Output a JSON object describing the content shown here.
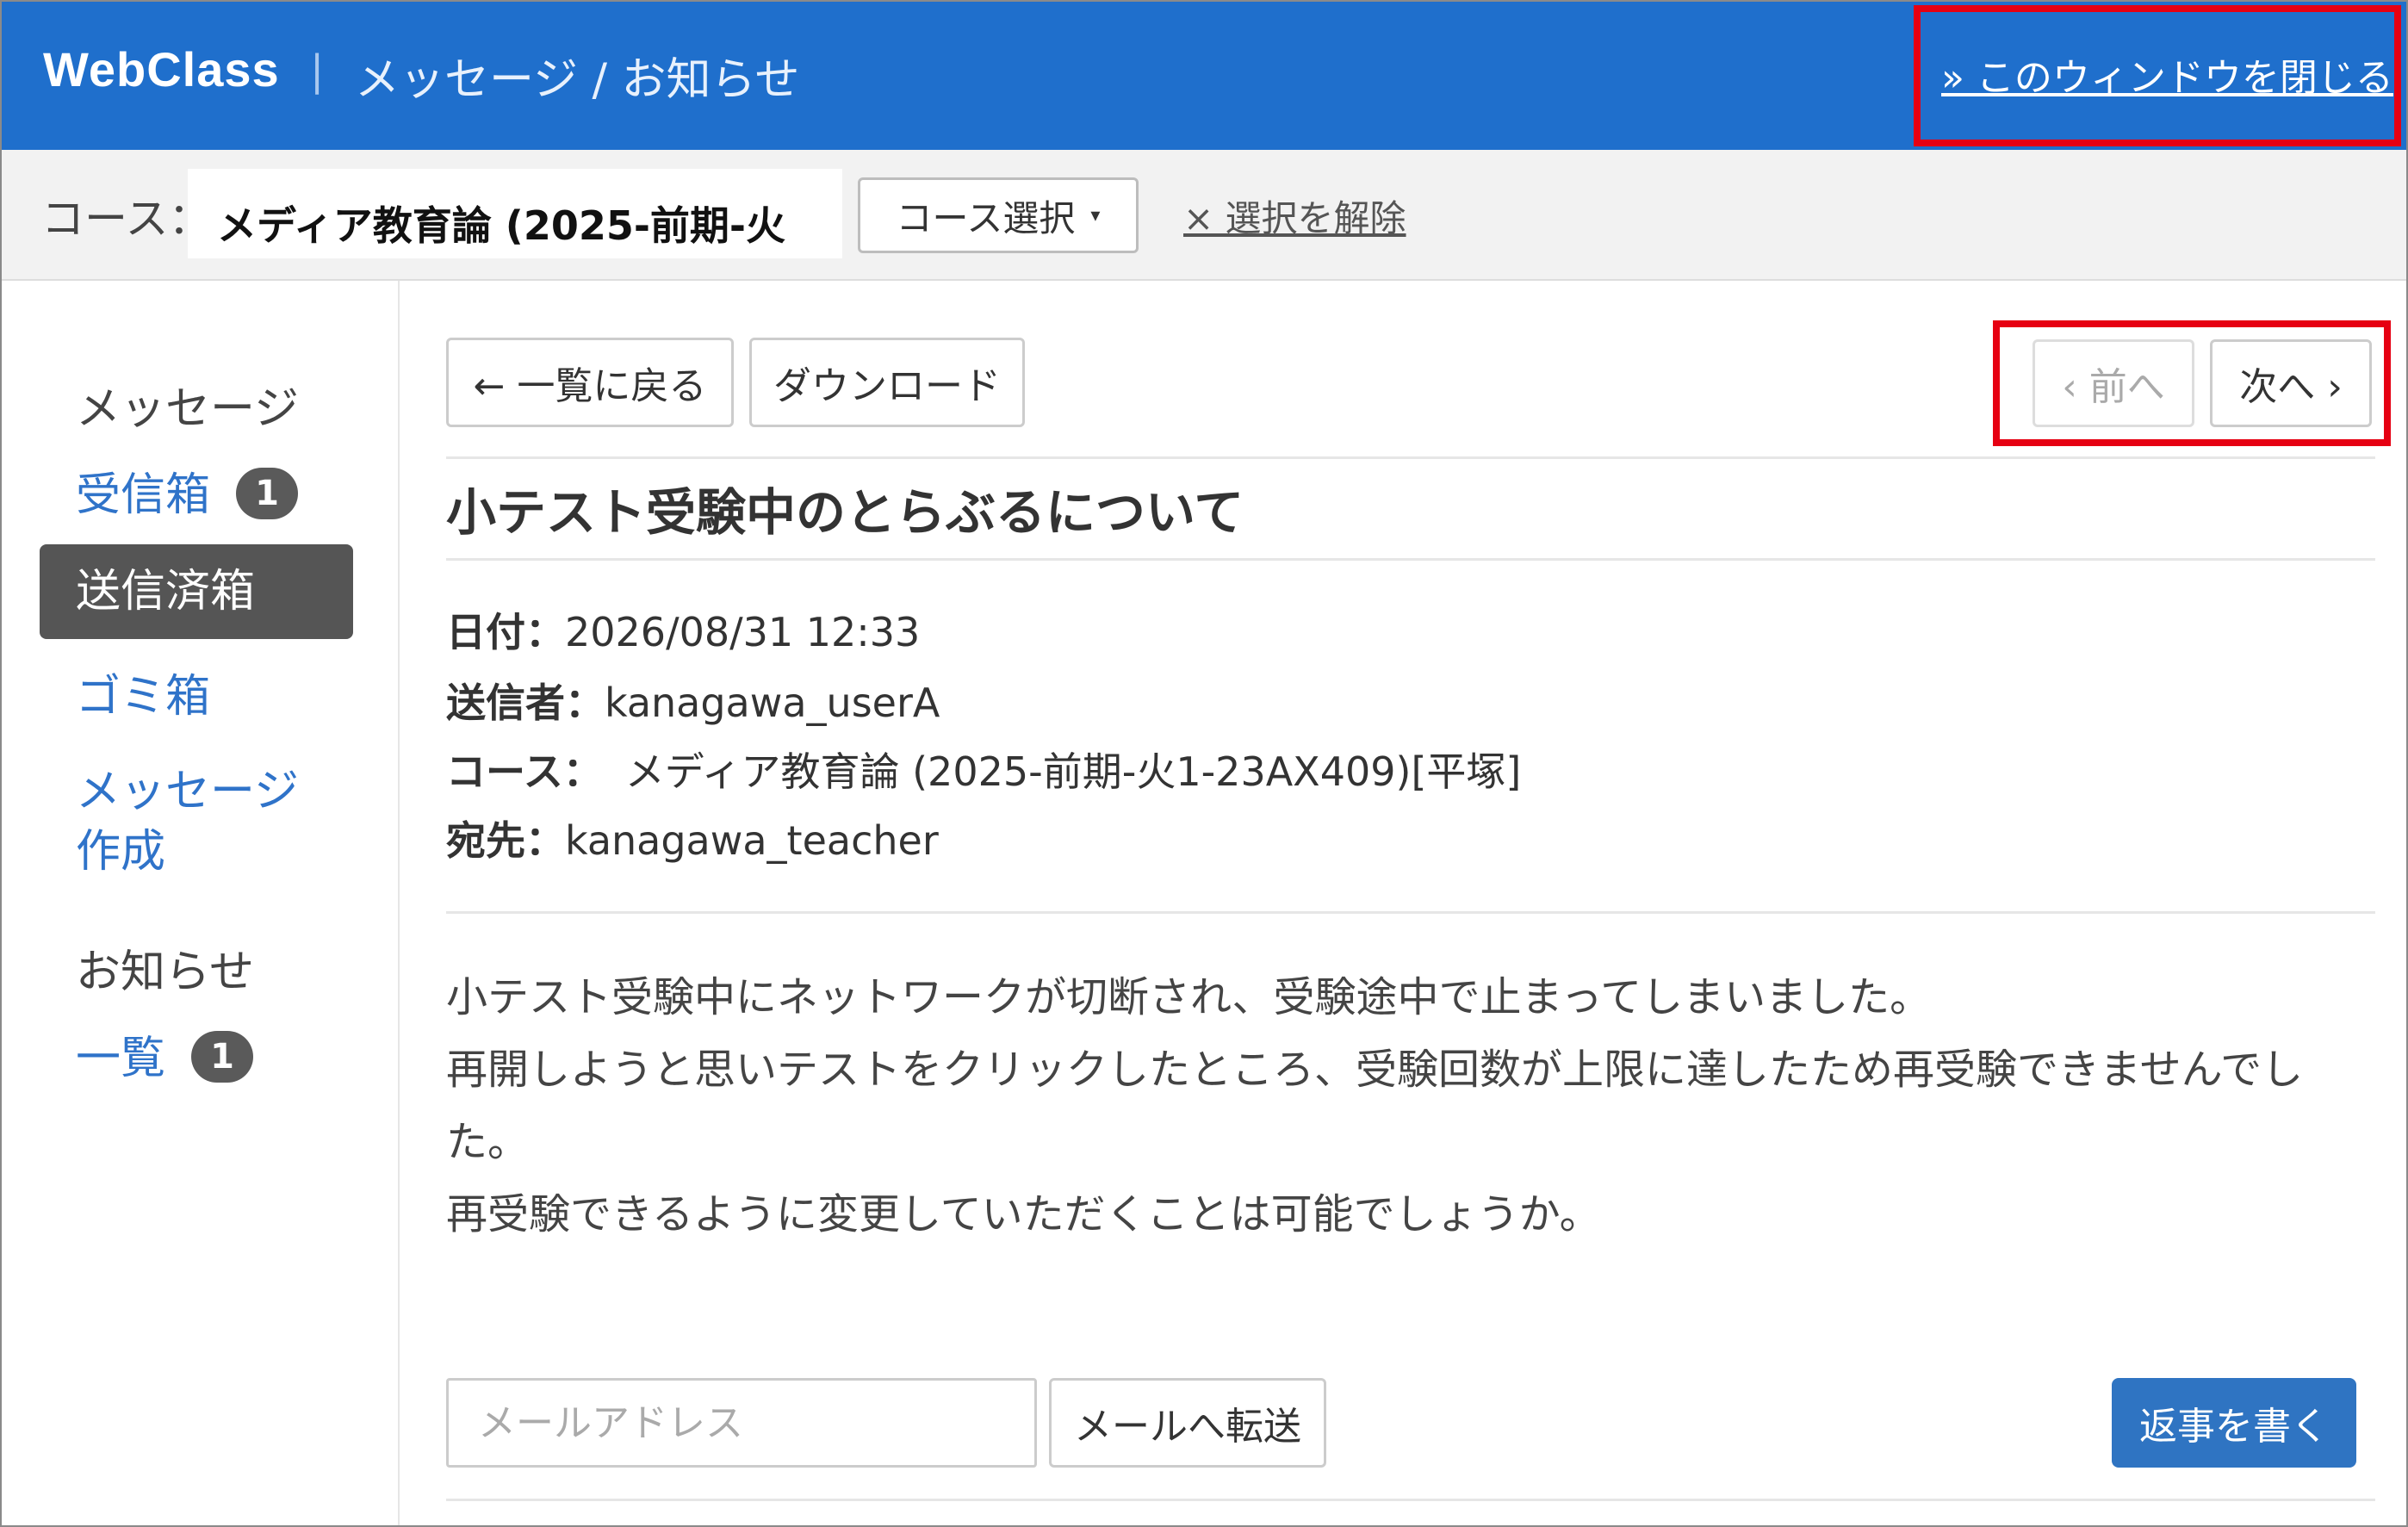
{
  "header": {
    "brand": "WebClass",
    "separator": "|",
    "title": "メッセージ / お知らせ",
    "close_link": "» このウィンドウを閉じる"
  },
  "course_bar": {
    "label": "コース：",
    "course_name": "メディア教育論 (2025-前期-火",
    "select_button": "コース選択",
    "caret": "▾",
    "clear_link": "× 選択を解除"
  },
  "sidebar": {
    "message_heading": "メッセージ",
    "inbox_label": "受信箱",
    "inbox_badge": "1",
    "sent_label": "送信済箱",
    "trash_label": "ゴミ箱",
    "compose_line1": "メッセージ",
    "compose_line2": "作成",
    "notice_heading": "お知らせ",
    "notice_list_label": "一覧",
    "notice_badge": "1"
  },
  "toolbar": {
    "back_button": "← 一覧に戻る",
    "download_button": "ダウンロード",
    "prev_button": "‹ 前へ",
    "next_button": "次へ ›"
  },
  "message": {
    "subject": "小テスト受験中のとらぶるについて",
    "date_label": "日付：",
    "date_value": "2026/08/31 12:33",
    "sender_label": "送信者：",
    "sender_value": "kanagawa_userA",
    "course_label": "コース：",
    "course_value": "メディア教育論 (2025-前期-火1-23AX409)[平塚]",
    "to_label": "宛先：",
    "to_value": "kanagawa_teacher",
    "body_lines": [
      "小テスト受験中にネットワークが切断され、受験途中で止まってしまいました。",
      "再開しようと思いテストをクリックしたところ、受験回数が上限に達したため再受験できませんでし",
      "た。",
      "再受験できるように変更していただくことは可能でしょうか。"
    ]
  },
  "footer": {
    "email_placeholder": "メールアドレス",
    "email_value": "",
    "forward_button": "メールへ転送",
    "reply_button": "返事を書く"
  },
  "colors": {
    "header_bg": "#1f6fcc",
    "link": "#2f73c9",
    "active_item": "#555555",
    "highlight": "#e60012",
    "reply_button": "#2f74c2"
  }
}
